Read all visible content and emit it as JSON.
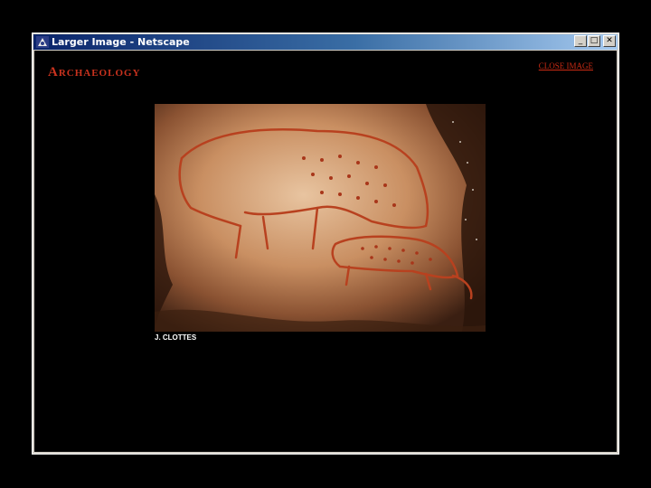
{
  "window": {
    "title": "Larger Image - Netscape",
    "app_icon": "netscape-icon",
    "controls": {
      "minimize": "_",
      "maximize": "□",
      "close": "✕"
    }
  },
  "page": {
    "logo_text": "Archaeology",
    "close_link": "CLOSE IMAGE",
    "photo_subject": "cave-painting-icon",
    "photo_credit": "J. CLOTTES"
  },
  "colors": {
    "title_bar_start": "#0a246a",
    "title_bar_end": "#a6caf0",
    "window_frame": "#d4d0c8",
    "page_background": "#000000",
    "logo_red": "#c8321e",
    "link_red": "#cc2b14"
  }
}
